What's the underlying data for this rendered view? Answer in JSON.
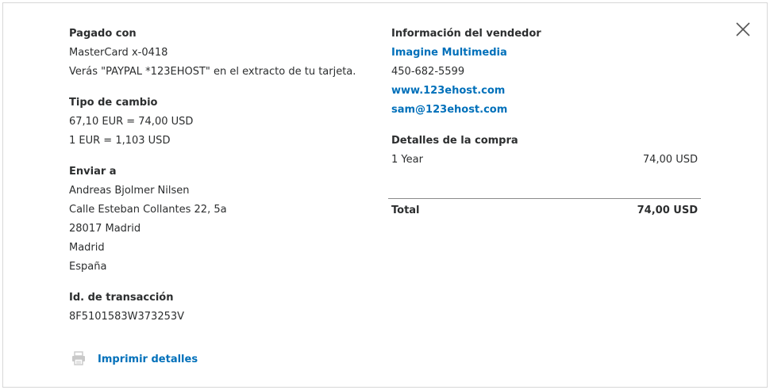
{
  "left": {
    "paid_with": {
      "label": "Pagado con",
      "card": "MasterCard x-0418",
      "statement_note": "Verás \"PAYPAL *123EHOST\" en el extracto de tu tarjeta."
    },
    "exchange": {
      "label": "Tipo de cambio",
      "line1": "67,10 EUR = 74,00 USD",
      "line2": "1 EUR = 1,103 USD"
    },
    "ship_to": {
      "label": "Enviar a",
      "lines": [
        "Andreas Bjolmer Nilsen",
        "Calle Esteban Collantes 22, 5a",
        "28017 Madrid",
        "Madrid",
        "España"
      ]
    },
    "transaction": {
      "label": "Id. de transacción",
      "id": "8F5101583W373253V"
    },
    "print_label": "Imprimir detalles"
  },
  "right": {
    "seller": {
      "label": "Información del vendedor",
      "name": "Imagine Multimedia",
      "phone": "450-682-5599",
      "website": "www.123ehost.com",
      "email": "sam@123ehost.com"
    },
    "purchase": {
      "label": "Detalles de la compra",
      "item_name": "1 Year",
      "item_amount": "74,00 USD"
    },
    "total": {
      "label": "Total",
      "amount": "74,00 USD"
    }
  },
  "icons": {
    "close": "close-icon",
    "print": "printer-icon"
  },
  "colors": {
    "link": "#0070ba",
    "text": "#2c2e2f",
    "border": "#d7d7d7",
    "icon_gray": "#c9c9c9"
  }
}
